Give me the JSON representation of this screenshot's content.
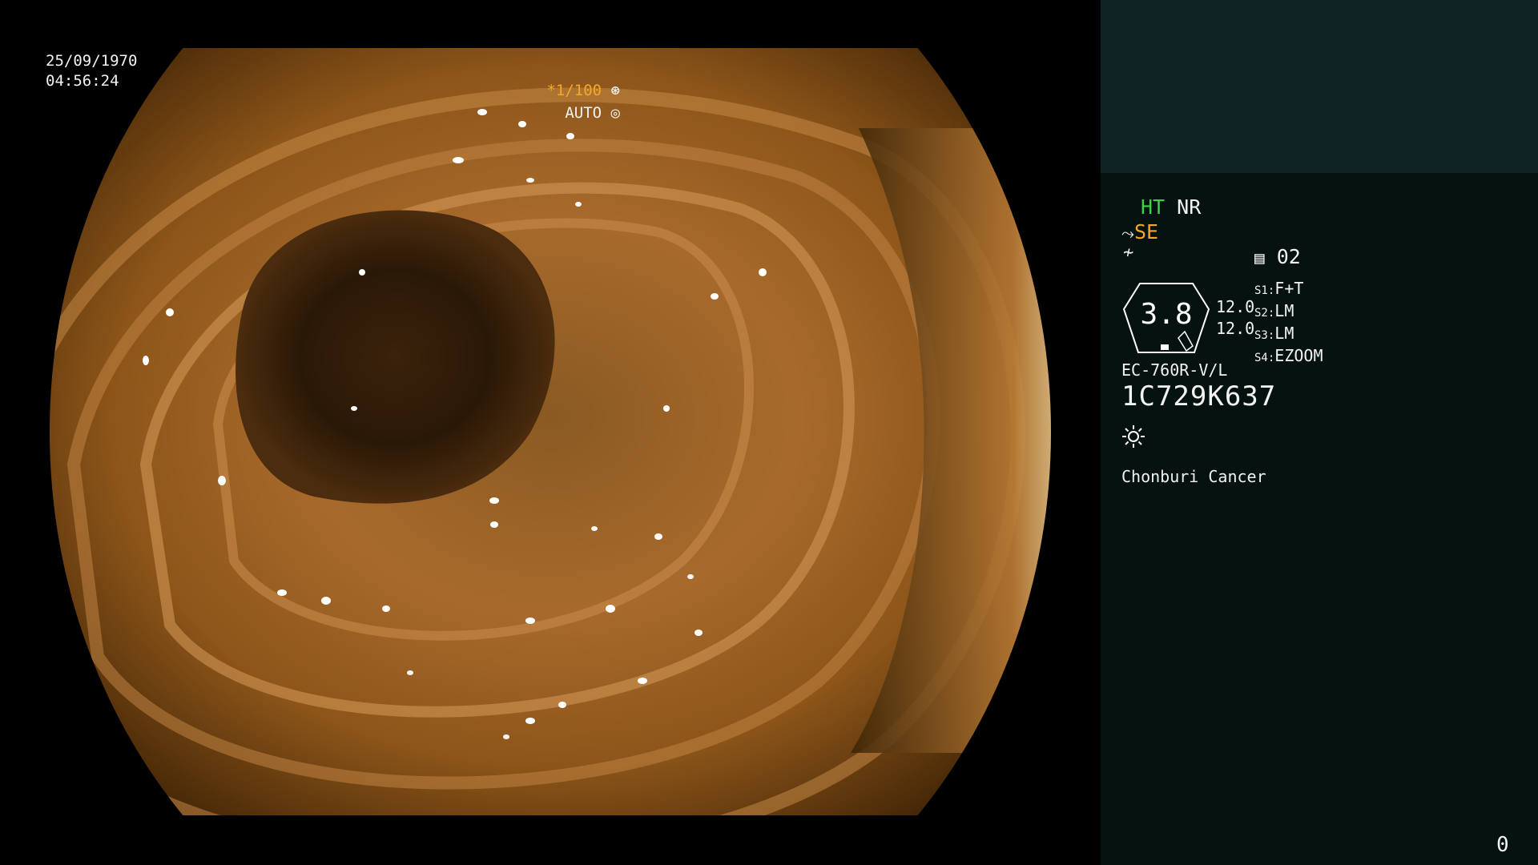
{
  "image_osd": {
    "date": "25/09/1970",
    "time": "04:56:24",
    "shutter_prefix": "*",
    "shutter": "1/100",
    "iris_mode": "AUTO"
  },
  "side_panel": {
    "mode_ht": "HT",
    "mode_nr": "NR",
    "se_label": "SE",
    "disk_number": "02",
    "main_value": "3.8",
    "values": [
      "12.0",
      "12.0"
    ],
    "slots": [
      {
        "key": "S1:",
        "value": "F+T"
      },
      {
        "key": "S2:",
        "value": "LM"
      },
      {
        "key": "S3:",
        "value": "LM"
      },
      {
        "key": "S4:",
        "value": "EZOOM"
      }
    ],
    "scope_model": "EC-760R-V/L",
    "serial": "1C729K637",
    "hospital": "Chonburi Cancer",
    "corner_number": "0"
  },
  "colors": {
    "panel_bg": "#051210",
    "panel_top": "#0f2324",
    "accent_orange": "#f3a826",
    "accent_green": "#3dd24a"
  },
  "icons": [
    "shutter-icon",
    "iris-icon",
    "pump-icon",
    "tilde-icon",
    "disk-icon",
    "hexagon-frame-icon",
    "sun-icon"
  ]
}
